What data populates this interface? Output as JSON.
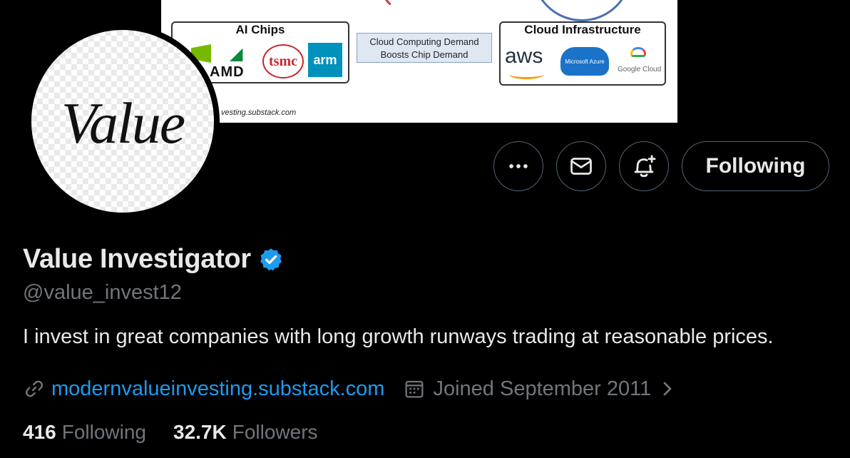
{
  "banner": {
    "chips_title": "AI Chips",
    "amd_label": "AMD",
    "tsmc_label": "tsmc",
    "arm_label": "arm",
    "cloud_demand_line1": "Cloud Computing Demand",
    "cloud_demand_line2": "Boosts Chip Demand",
    "infra_title": "Cloud Infrastructure",
    "aws_label": "aws",
    "azure_label": "Microsoft Azure",
    "gcloud_label": "Google Cloud",
    "url_fragment": "vesting.substack.com"
  },
  "avatar": {
    "text": "Value"
  },
  "actions": {
    "following_label": "Following"
  },
  "profile": {
    "display_name": "Value Investigator",
    "handle": "@value_invest12",
    "bio": "I invest in great companies with long growth runways trading at reasonable prices.",
    "website": "modernvalueinvesting.substack.com",
    "joined": "Joined September 2011"
  },
  "stats": {
    "following_count": "416",
    "following_label": "Following",
    "followers_count": "32.7K",
    "followers_label": "Followers"
  },
  "colors": {
    "background": "#000000",
    "primary_text": "#e7e9ea",
    "secondary_text": "#71767b",
    "accent": "#1d9bf0",
    "border": "#536471"
  },
  "icons": [
    "more-icon",
    "mail-icon",
    "bell-plus-icon",
    "verified-badge-icon",
    "link-icon",
    "calendar-icon",
    "chevron-right-icon"
  ]
}
